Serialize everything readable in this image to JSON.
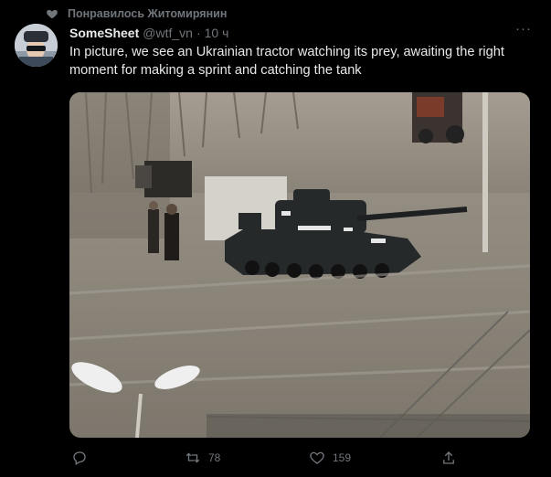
{
  "social_context": {
    "text": "Понравилось Житомирянин",
    "icon": "heart-icon"
  },
  "tweet": {
    "author_name": "SomeSheet",
    "author_handle": "@wtf_vn",
    "separator": "·",
    "time": "10 ч",
    "more_label": "···",
    "text": "In picture, we see an Ukrainian tractor watching its prey, awaiting the right moment for making a sprint and catching the tank"
  },
  "actions": {
    "reply": {
      "icon": "reply-icon",
      "count": ""
    },
    "retweet": {
      "icon": "retweet-icon",
      "count": "78"
    },
    "like": {
      "icon": "like-icon",
      "count": "159"
    },
    "share": {
      "icon": "share-icon"
    }
  },
  "colors": {
    "background": "#000000",
    "text": "#e7e9ea",
    "muted": "#71767b"
  }
}
